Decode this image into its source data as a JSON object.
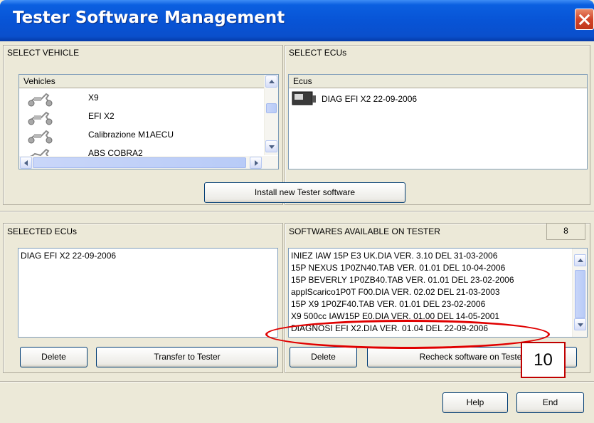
{
  "window": {
    "title": "Tester Software Management"
  },
  "select_vehicle": {
    "label": "SELECT VEHICLE",
    "column_header": "Vehicles",
    "items": [
      {
        "label": "X9",
        "icon": "scooter-icon"
      },
      {
        "label": "EFI X2",
        "icon": "scooter-icon"
      },
      {
        "label": "Calibrazione M1AECU",
        "icon": "scooter-icon"
      },
      {
        "label": "ABS COBRA2",
        "icon": "scooter-icon"
      }
    ]
  },
  "select_ecus": {
    "label": "SELECT ECUs",
    "column_header": "Ecus",
    "items": [
      {
        "label": "DIAG EFI X2 22-09-2006",
        "icon": "ecu-icon"
      }
    ]
  },
  "install_button": "Install new Tester software",
  "selected_ecus": {
    "label": "SELECTED ECUs",
    "items": [
      "DIAG EFI X2 22-09-2006"
    ]
  },
  "softwares_available": {
    "label": "SOFTWARES AVAILABLE ON TESTER",
    "count": "8",
    "items": [
      "INIEZ IAW 15P E3 UK.DIA VER. 3.10 DEL 31-03-2006",
      "15P NEXUS 1P0ZN40.TAB VER. 01.01 DEL 10-04-2006",
      "15P BEVERLY 1P0ZB40.TAB VER. 01.01 DEL 23-02-2006",
      "applScarico1P0T F00.DIA VER. 02.02 DEL 21-03-2003",
      "15P X9 1P0ZF40.TAB VER. 01.01 DEL 23-02-2006",
      "X9 500cc IAW15P E0.DIA VER. 01.00 DEL 14-05-2001",
      "DIAGNOSI EFI X2.DIA VER. 01.04 DEL 22-09-2006"
    ]
  },
  "buttons": {
    "delete_left": "Delete",
    "transfer": "Transfer to Tester",
    "delete_right": "Delete",
    "recheck": "Recheck software on Tester",
    "help": "Help",
    "end": "End"
  },
  "annotation": {
    "callout_number": "10",
    "color": "#e00000"
  }
}
